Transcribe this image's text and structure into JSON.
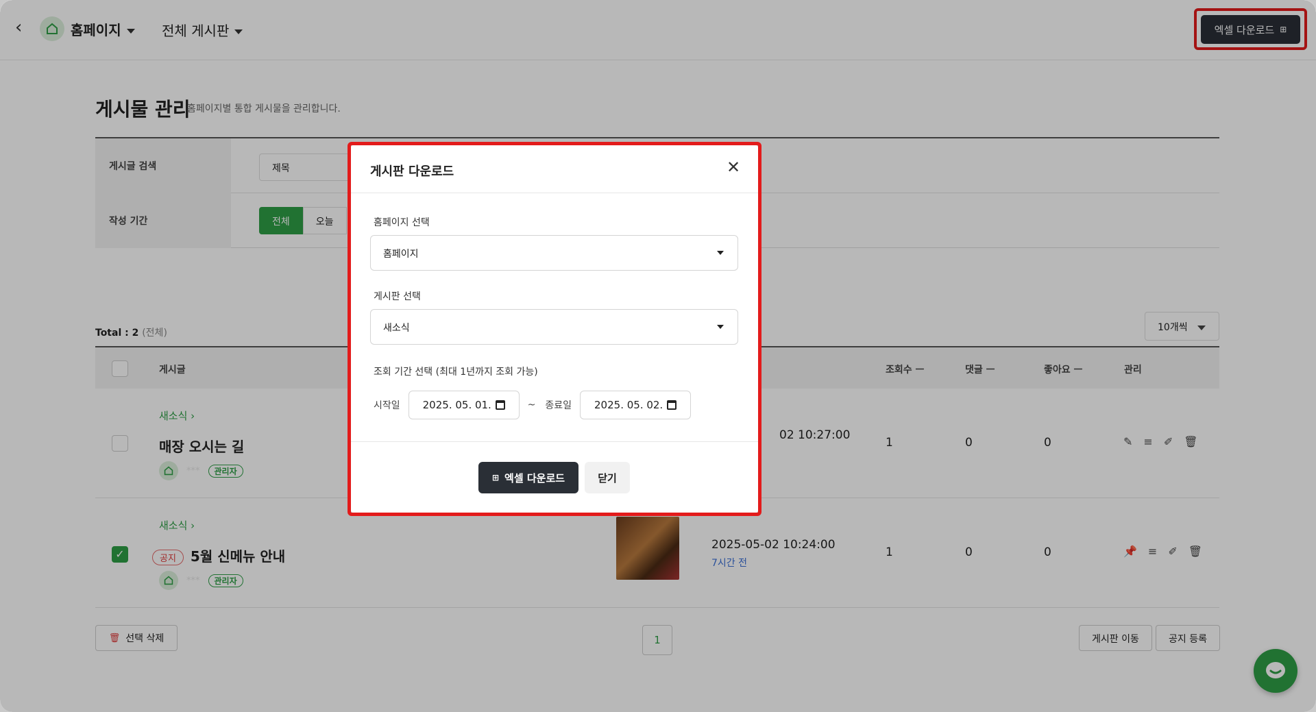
{
  "topbar": {
    "home_title": "홈페이지",
    "board_select": "전체 게시판",
    "excel_download": "엑셀 다운로드"
  },
  "heading": {
    "title": "게시물 관리",
    "desc": "홈페이지별 통합 게시물을 관리합니다."
  },
  "filter": {
    "search_label": "게시글 검색",
    "search_field": "제목",
    "period_label": "작성 기간",
    "period_all": "전체",
    "period_today": "오늘"
  },
  "list": {
    "total_label": "Total : 2",
    "total_scope": "(전체)",
    "per_page": "10개씩"
  },
  "table": {
    "headers": {
      "post": "게시글",
      "views": "조회수 ㅡ",
      "comments": "댓글 ㅡ",
      "likes": "좋아요 ㅡ",
      "manage": "관리"
    },
    "rows": [
      {
        "category": "새소식",
        "title": "매장 오시는 길",
        "author_tag": "관리자",
        "author_name": "***",
        "date": "02 10:27:00",
        "views": "1",
        "comments": "0",
        "likes": "0",
        "checked": false
      },
      {
        "category": "새소식",
        "notice": "공지",
        "title": "5월 신메뉴 안내",
        "author_tag": "관리자",
        "author_name": "***",
        "date": "2025-05-02 10:24:00",
        "relative": "7시간 전",
        "views": "1",
        "comments": "0",
        "likes": "0",
        "checked": true
      }
    ]
  },
  "footer": {
    "delete_selected": "선택 삭제",
    "page": "1",
    "move_board": "게시판 이동",
    "register_notice": "공지 등록"
  },
  "modal": {
    "title": "게시판 다운로드",
    "homepage_label": "홈페이지 선택",
    "homepage_value": "홈페이지",
    "board_label": "게시판 선택",
    "board_value": "새소식",
    "period_label": "조회 기간 선택 (최대 1년까지 조회 가능)",
    "start_label": "시작일",
    "start_date": "2025. 05. 01.",
    "tilde": "~",
    "end_label": "종료일",
    "end_date": "2025. 05. 02.",
    "excel_button": "엑셀 다운로드",
    "close_button": "닫기"
  },
  "colors": {
    "accent": "#2e9e46",
    "dark_button": "#2a2f36",
    "highlight": "#e31b1b"
  }
}
